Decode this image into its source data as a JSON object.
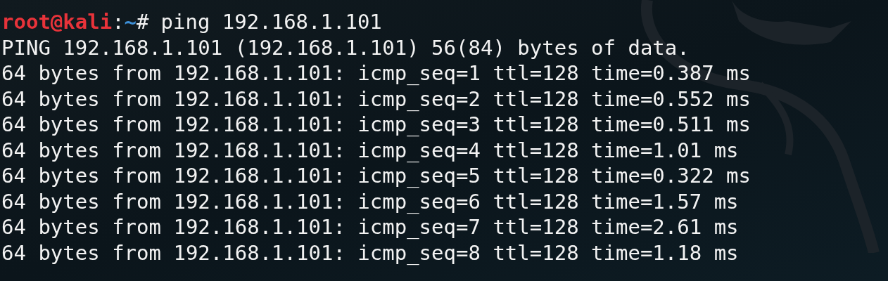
{
  "prompt": {
    "user": "root@kali",
    "separator": ":",
    "path": "~",
    "symbol": "#",
    "command": "ping 192.168.1.101"
  },
  "output": [
    "PING 192.168.1.101 (192.168.1.101) 56(84) bytes of data.",
    "64 bytes from 192.168.1.101: icmp_seq=1 ttl=128 time=0.387 ms",
    "64 bytes from 192.168.1.101: icmp_seq=2 ttl=128 time=0.552 ms",
    "64 bytes from 192.168.1.101: icmp_seq=3 ttl=128 time=0.511 ms",
    "64 bytes from 192.168.1.101: icmp_seq=4 ttl=128 time=1.01 ms",
    "64 bytes from 192.168.1.101: icmp_seq=5 ttl=128 time=0.322 ms",
    "64 bytes from 192.168.1.101: icmp_seq=6 ttl=128 time=1.57 ms",
    "64 bytes from 192.168.1.101: icmp_seq=7 ttl=128 time=2.61 ms",
    "64 bytes from 192.168.1.101: icmp_seq=8 ttl=128 time=1.18 ms"
  ]
}
